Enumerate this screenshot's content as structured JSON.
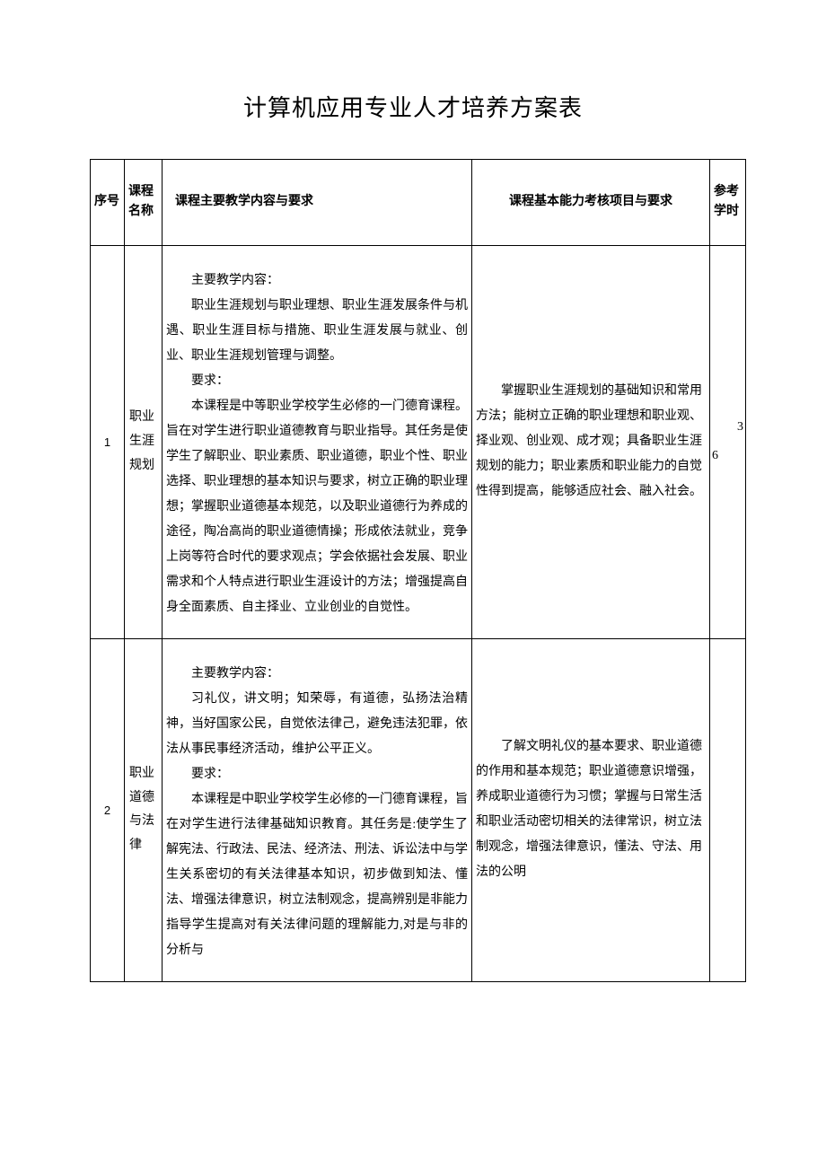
{
  "title": "计算机应用专业人才培养方案表",
  "headers": {
    "seq": "序号",
    "name": "课程名称",
    "content": "课程主要教学内容与要求",
    "assess": "课程基本能力考核项目与要求",
    "hours": "参考学时"
  },
  "rows": [
    {
      "seq": "1",
      "name": "职业生涯规划",
      "content_heading1": "主要教学内容：",
      "content_p1": "职业生涯规划与职业理想、职业生涯发展条件与机遇、职业生涯目标与措施、职业生涯发展与就业、创业、职业生涯规划管理与调整。",
      "content_heading2": "要求：",
      "content_p2": "本课程是中等职业学校学生必修的一门德育课程。旨在对学生进行职业道德教育与职业指导。其任务是使学生了解职业、职业素质、职业道德，职业个性、职业选择、职业理想的基本知识与要求，树立正确的职业理想；掌握职业道德基本规范，以及职业道德行为养成的途径，陶冶高尚的职业道德情操；形成依法就业，竞争上岗等符合时代的要求观点；学会依据社会发展、职业需求和个人特点进行职业生涯设计的方法；增强提高自身全面素质、自主择业、立业创业的自觉性。",
      "assess": "掌握职业生涯规划的基础知识和常用方法；能树立正确的职业理想和职业观、择业观、创业观、成才观；具备职业生涯规划的能力；职业素质和职业能力的自觉性得到提高，能够适应社会、融入社会。",
      "hours_top": "3",
      "hours_bottom": "6"
    },
    {
      "seq": "2",
      "name": "职业道德与法律",
      "content_heading1": "主要教学内容：",
      "content_p1": "习礼仪，讲文明；知荣辱，有道德，弘扬法治精神，当好国家公民，自觉依法律己，避免违法犯罪，依法从事民事经济活动，维护公平正义。",
      "content_heading2": "要求：",
      "content_p2": "本课程是中职业学校学生必修的一门德育课程，旨在对学生进行法律基础知识教育。其任务是:使学生了解宪法、行政法、民法、经济法、刑法、诉讼法中与学生关系密切的有关法律基本知识，初步做到知法、懂法、增强法律意识，树立法制观念，提高辨别是非能力指导学生提高对有关法律问题的理解能力,对是与非的分析与",
      "assess": "了解文明礼仪的基本要求、职业道德的作用和基本规范；职业道德意识增强，养成职业道德行为习惯；掌握与日常生活和职业活动密切相关的法律常识，树立法制观念，增强法律意识，懂法、守法、用法的公明",
      "hours_top": "",
      "hours_bottom": ""
    }
  ]
}
